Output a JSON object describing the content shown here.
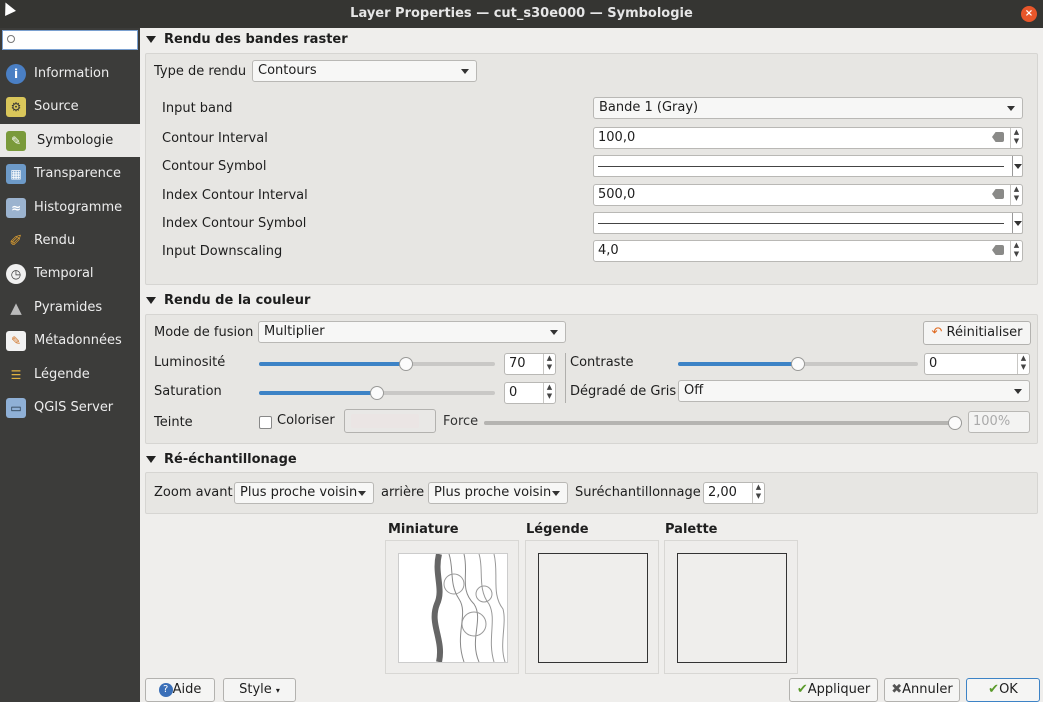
{
  "window": {
    "title": "Layer Properties — cut_s30e000 — Symbologie",
    "close_glyph": "×"
  },
  "sidebar": {
    "search_placeholder": "",
    "items": [
      {
        "label": "Information",
        "icon": "info-icon"
      },
      {
        "label": "Source",
        "icon": "source-icon"
      },
      {
        "label": "Symbologie",
        "icon": "paintbrush-icon",
        "selected": true
      },
      {
        "label": "Transparence",
        "icon": "transparency-icon"
      },
      {
        "label": "Histogramme",
        "icon": "histogram-icon"
      },
      {
        "label": "Rendu",
        "icon": "brush-icon"
      },
      {
        "label": "Temporal",
        "icon": "clock-icon"
      },
      {
        "label": "Pyramides",
        "icon": "pyramid-icon"
      },
      {
        "label": "Métadonnées",
        "icon": "metadata-icon"
      },
      {
        "label": "Légende",
        "icon": "legend-icon"
      },
      {
        "label": "QGIS Server",
        "icon": "server-icon"
      }
    ]
  },
  "band_rendering": {
    "header": "Rendu des bandes raster",
    "render_type_label": "Type de rendu",
    "render_type_value": "Contours",
    "input_band_label": "Input band",
    "input_band_value": "Bande 1 (Gray)",
    "contour_interval_label": "Contour Interval",
    "contour_interval_value": "100,0",
    "contour_symbol_label": "Contour Symbol",
    "index_interval_label": "Index Contour Interval",
    "index_interval_value": "500,0",
    "index_symbol_label": "Index Contour Symbol",
    "downscaling_label": "Input Downscaling",
    "downscaling_value": "4,0"
  },
  "color_rendering": {
    "header": "Rendu de la couleur",
    "blend_label": "Mode de fusion",
    "blend_value": "Multiplier",
    "reset_label": "Réinitialiser",
    "brightness_label": "Luminosité",
    "brightness_value": "70",
    "brightness_level": 0.58,
    "contrast_label": "Contraste",
    "contrast_value": "0",
    "contrast_level": 0.5,
    "saturation_label": "Saturation",
    "saturation_value": "0",
    "saturation_level": 0.5,
    "grayscale_label": "Dégradé de Gris",
    "grayscale_value": "Off",
    "hue_label": "Teinte",
    "colorize_label": "Coloriser",
    "strength_label": "Force",
    "strength_value": "100%",
    "strength_level": 1.0
  },
  "resampling": {
    "header": "Ré-échantillonage",
    "zoom_in_label": "Zoom avant",
    "zoom_in_value": "Plus proche voisin",
    "zoom_out_label": "arrière",
    "zoom_out_value": "Plus proche voisin",
    "oversampling_label": "Suréchantillonnage",
    "oversampling_value": "2,00"
  },
  "previews": {
    "thumbnail": "Miniature",
    "legend": "Légende",
    "palette": "Palette"
  },
  "footer": {
    "help": "Aide",
    "style": "Style",
    "apply": "Appliquer",
    "cancel": "Annuler",
    "ok": "OK"
  },
  "colors": {
    "accent": "#3d83c6",
    "sidebar": "#3c3c3a",
    "titlebar": "#353532",
    "close": "#e8562a"
  }
}
